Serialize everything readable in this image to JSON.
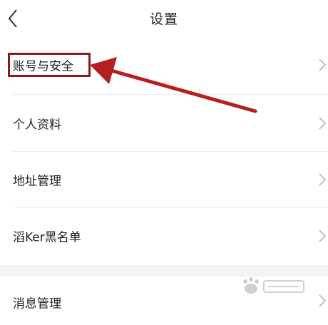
{
  "header": {
    "title": "设置",
    "back_icon": "chevron-left-icon"
  },
  "menu": {
    "items": [
      {
        "label": "账号与安全",
        "icon": "chevron-right-icon"
      },
      {
        "label": "个人资料",
        "icon": "chevron-right-icon"
      },
      {
        "label": "地址管理",
        "icon": "chevron-right-icon"
      },
      {
        "label": "滔Ker黑名单",
        "icon": "chevron-right-icon"
      },
      {
        "label": "消息管理",
        "icon": "chevron-right-icon"
      }
    ]
  },
  "annotation": {
    "color": "#b5201f",
    "box_color": "#8a1a1e"
  },
  "watermark": {
    "name": "baidu-jingyan-watermark"
  }
}
